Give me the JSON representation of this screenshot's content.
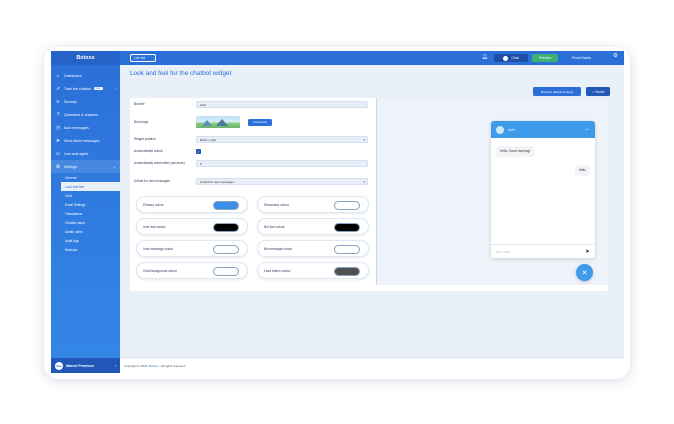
{
  "app": {
    "brand": "Botxss"
  },
  "sidebar": {
    "items": [
      {
        "label": "Dashboard",
        "icon": "home-icon"
      },
      {
        "label": "Train the chatbot",
        "icon": "rocket-icon",
        "badge": "new"
      },
      {
        "label": "Surveys",
        "icon": "list-icon"
      },
      {
        "label": "Questions & answers",
        "icon": "help-icon"
      },
      {
        "label": "Auto messages",
        "icon": "clock-icon"
      },
      {
        "label": "Send direct messages",
        "icon": "send-icon"
      },
      {
        "label": "Live chat agent",
        "icon": "chat-icon"
      },
      {
        "label": "Settings",
        "icon": "settings-icon"
      }
    ],
    "settings_sub": [
      "General",
      "Look and feel",
      "Chat",
      "Email Settings",
      "Translations",
      "Chatbot users",
      "Admin users",
      "Audit logs",
      "Backups"
    ],
    "footer_label": "Marvel Premium",
    "footer_avatar": "Bot"
  },
  "topbar": {
    "dropdown": "Live bot",
    "chat_label": "Chat",
    "preview_label": "Preview",
    "user_name": "Pinoh Kazila"
  },
  "page": {
    "title": "Look and feel for the chatbot widget",
    "reset_button": "Reset to default settings",
    "saved_button": "Saved"
  },
  "form": {
    "bot_title_label": "Bot title",
    "bot_title_value": "Avril",
    "bot_image_label": "Bot image",
    "choose_file": "Choose file",
    "widget_position_label": "Widget position",
    "widget_position_value": "Bottom right",
    "auto_unfold_label": "Automatically unfold",
    "auto_unfold_after_label": "Automatically unfold after (seconds)",
    "auto_unfold_after_value": "5",
    "unfold_new_messages_label": "Unfold for new messages",
    "unfold_new_messages_value": "Unfold for new messages"
  },
  "colors": [
    {
      "label": "Primary colour",
      "value": "#3b8fe8"
    },
    {
      "label": "Secondary colour",
      "value": "#ffffff"
    },
    {
      "label": "User font colour",
      "value": "#000000"
    },
    {
      "label": "Bot font colour",
      "value": "#000000"
    },
    {
      "label": "User message colour",
      "value": "#ffffff"
    },
    {
      "label": "Bot message colour",
      "value": "#ffffff"
    },
    {
      "label": "Chat background colour",
      "value": "#ffffff"
    },
    {
      "label": "Lead button colour",
      "value": "#505050"
    }
  ],
  "chat_preview": {
    "bot_name": "Avril",
    "bot_message": "Hello, Good morning!",
    "user_message": "Hello",
    "input_placeholder": "Start chat!"
  },
  "footer": {
    "prefix": "Copyright © 2023",
    "link": "Botxss",
    "suffix": ". All rights reserved."
  }
}
